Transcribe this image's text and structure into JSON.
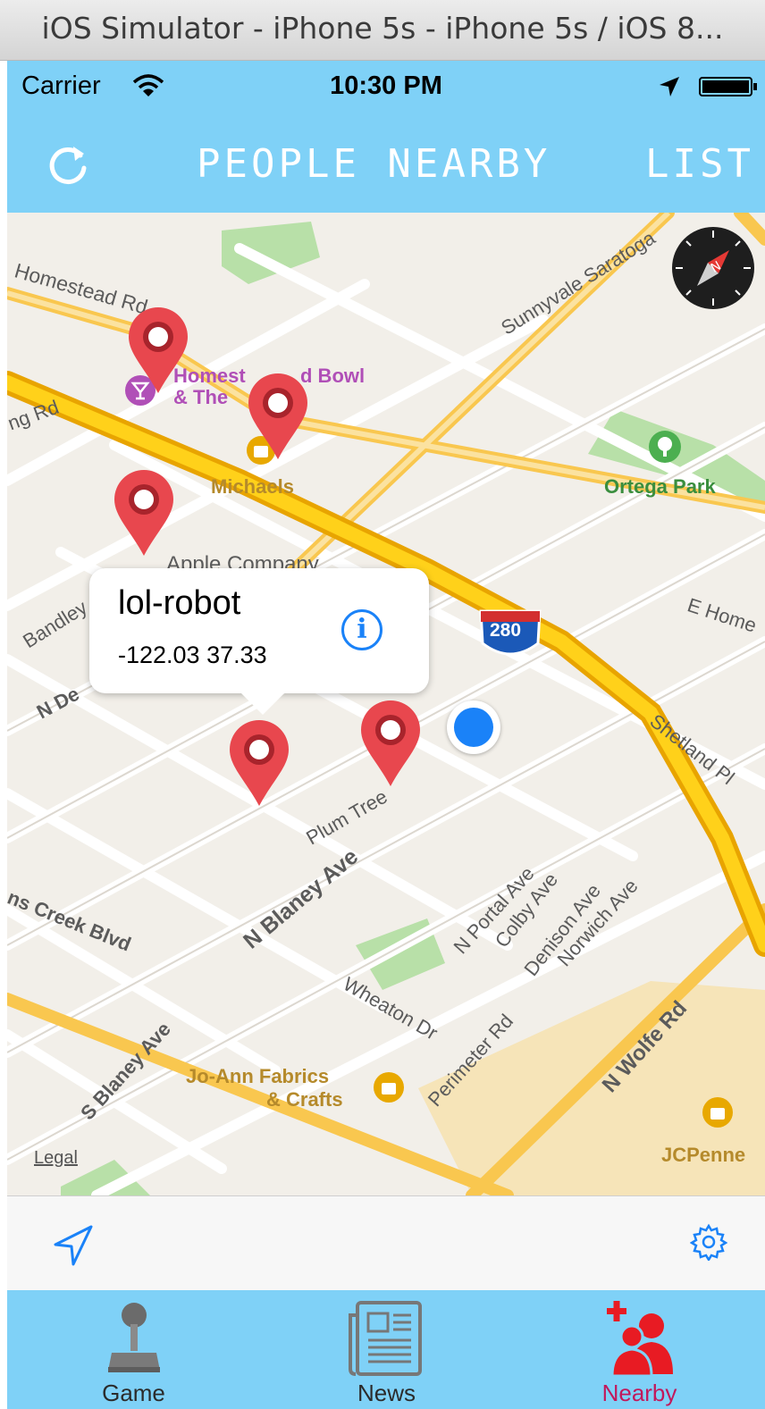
{
  "window": {
    "title": "iOS Simulator - iPhone 5s - iPhone 5s / iOS 8..."
  },
  "status_bar": {
    "carrier": "Carrier",
    "time": "10:30 PM"
  },
  "nav_bar": {
    "title": "PEOPLE NEARBY",
    "right_button": "LIST",
    "left_icon": "refresh-icon"
  },
  "map": {
    "legal": "Legal",
    "labels": {
      "homestead_rd": "Homestead Rd",
      "ng_rd": "ng Rd",
      "sunnyvale_saratoga": "Sunnyvale Saratoga",
      "e_homestead": "E Home",
      "apple_company": "Apple Company",
      "bandley": "Bandley",
      "n_de": "N De",
      "shetland_pl": "Shetland Pl",
      "plum_tree": "Plum Tree",
      "n_blaney_ave": "N Blaney Ave",
      "creek_blvd": "ns Creek Blvd",
      "s_blaney_ave": "S Blaney Ave",
      "wheaton_dr": "Wheaton Dr",
      "perimeter_rd": "Perimeter Rd",
      "n_portal_ave": "N Portal Ave",
      "colby_ave": "Colby Ave",
      "denison_ave": "Denison Ave",
      "norwich_ave": "Norwich Ave",
      "n_wolfe_rd": "N Wolfe Rd",
      "highway_shield": "280"
    },
    "pois": {
      "homestead_bowl_1": "Homest",
      "homestead_bowl_2": "d Bowl",
      "homestead_bowl_3": "& The",
      "michaels": "Michaels",
      "ortega_park": "Ortega Park",
      "joann_1": "Jo-Ann Fabrics",
      "joann_2": "& Crafts",
      "jcpenney": "JCPenne"
    },
    "callout": {
      "title": "lol-robot",
      "subtitle": "-122.03  37.33"
    }
  },
  "tab_bar": {
    "tabs": [
      {
        "label": "Game",
        "icon": "joystick-icon",
        "color": "#2b2b2b"
      },
      {
        "label": "News",
        "icon": "newspaper-icon",
        "color": "#2b2b2b"
      },
      {
        "label": "Nearby",
        "icon": "people-add-icon",
        "color": "#c2185b",
        "selected": true
      }
    ]
  },
  "colors": {
    "bar": "#7fd1f7",
    "pin": "#e8474e",
    "user_location": "#1a82f8",
    "selected_tab": "#c2185b"
  }
}
